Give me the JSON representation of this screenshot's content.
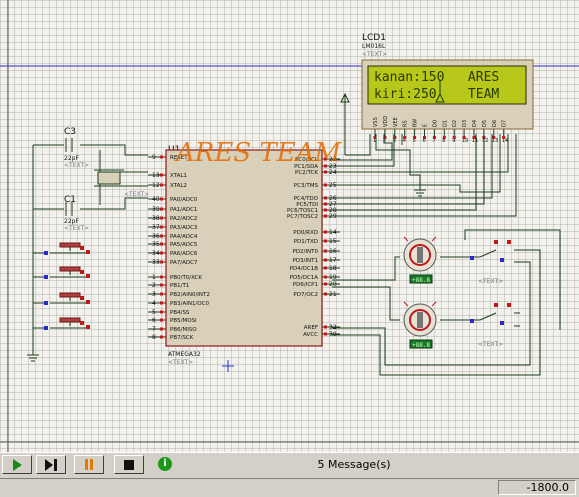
{
  "lcd": {
    "ref": "LCD1",
    "part": "LM016L",
    "text_tag": "<TEXT>",
    "line1": "kanan:150   ARES",
    "line2": "kiri:250    TEAM",
    "pins": [
      "VSS",
      "VDD",
      "VEE",
      "RS",
      "RW",
      "E",
      "D0",
      "D1",
      "D2",
      "D3",
      "D4",
      "D5",
      "D6",
      "D7"
    ],
    "pin_nums": [
      "1",
      "2",
      "3",
      "4",
      "5",
      "6",
      "7",
      "8",
      "9",
      "10",
      "11",
      "12",
      "13",
      "14"
    ]
  },
  "mcu": {
    "ref": "U1",
    "part": "ATMEGA32",
    "text_tag": "<TEXT>",
    "left_pins": [
      {
        "num": "9",
        "name": "RESET"
      },
      {
        "num": "13",
        "name": "XTAL1"
      },
      {
        "num": "12",
        "name": "XTAL2"
      },
      {
        "num": "40",
        "name": "PA0/ADC0"
      },
      {
        "num": "39",
        "name": "PA1/ADC1"
      },
      {
        "num": "38",
        "name": "PA2/ADC2"
      },
      {
        "num": "37",
        "name": "PA3/ADC3"
      },
      {
        "num": "36",
        "name": "PA4/ADC4"
      },
      {
        "num": "35",
        "name": "PA5/ADC5"
      },
      {
        "num": "34",
        "name": "PA6/ADC6"
      },
      {
        "num": "33",
        "name": "PA7/ADC7"
      },
      {
        "num": "1",
        "name": "PB0/T0/XCK"
      },
      {
        "num": "2",
        "name": "PB1/T1"
      },
      {
        "num": "3",
        "name": "PB2/AIN0/INT2"
      },
      {
        "num": "4",
        "name": "PB3/AIN1/OC0"
      },
      {
        "num": "5",
        "name": "PB4/SS"
      },
      {
        "num": "6",
        "name": "PB5/MOSI"
      },
      {
        "num": "7",
        "name": "PB6/MISO"
      },
      {
        "num": "8",
        "name": "PB7/SCK"
      }
    ],
    "right_pins": [
      {
        "num": "22",
        "name": "PC0/SCL"
      },
      {
        "num": "23",
        "name": "PC1/SDA"
      },
      {
        "num": "24",
        "name": "PC2/TCK"
      },
      {
        "num": "25",
        "name": "PC3/TMS"
      },
      {
        "num": "26",
        "name": "PC4/TDO"
      },
      {
        "num": "27",
        "name": "PC5/TDI"
      },
      {
        "num": "28",
        "name": "PC6/TOSC1"
      },
      {
        "num": "29",
        "name": "PC7/TOSC2"
      },
      {
        "num": "14",
        "name": "PD0/RXD"
      },
      {
        "num": "15",
        "name": "PD1/TXD"
      },
      {
        "num": "16",
        "name": "PD2/INT0"
      },
      {
        "num": "17",
        "name": "PD3/INT1"
      },
      {
        "num": "18",
        "name": "PD4/OC1B"
      },
      {
        "num": "19",
        "name": "PD5/OC1A"
      },
      {
        "num": "20",
        "name": "PD6/ICP1"
      },
      {
        "num": "21",
        "name": "PD7/OC2"
      },
      {
        "num": "32",
        "name": "AREF"
      },
      {
        "num": "30",
        "name": "AVCC"
      }
    ]
  },
  "caps": [
    {
      "ref": "C3",
      "value": "22pF",
      "text_tag": "<TEXT>"
    },
    {
      "ref": "C1",
      "value": "22pF",
      "text_tag": "<TEXT>"
    }
  ],
  "crystal": {
    "text_tag": "<TEXT>"
  },
  "watermark": "ARES TEAM",
  "motors": [
    {
      "readout": "+88.8"
    },
    {
      "readout": "+88.8"
    }
  ],
  "motor_text_tag": "<TEXT>",
  "status": {
    "messages": "5 Message(s)",
    "coordinate": "-1800.0"
  },
  "controls": {
    "play": "play-icon",
    "step": "step-icon",
    "pause": "pause-icon",
    "stop": "stop-icon",
    "info": "i"
  },
  "colors": {
    "wire": "#1a3d1a",
    "lcd_bg": "#b7c81b",
    "lcd_text": "#2a3a00",
    "chip_fill": "#d8d0b8",
    "chip_border": "#8b1a1a",
    "pin_red": "#c0181a",
    "watermark": "#e36a00",
    "blue_line": "#2a2acc"
  }
}
